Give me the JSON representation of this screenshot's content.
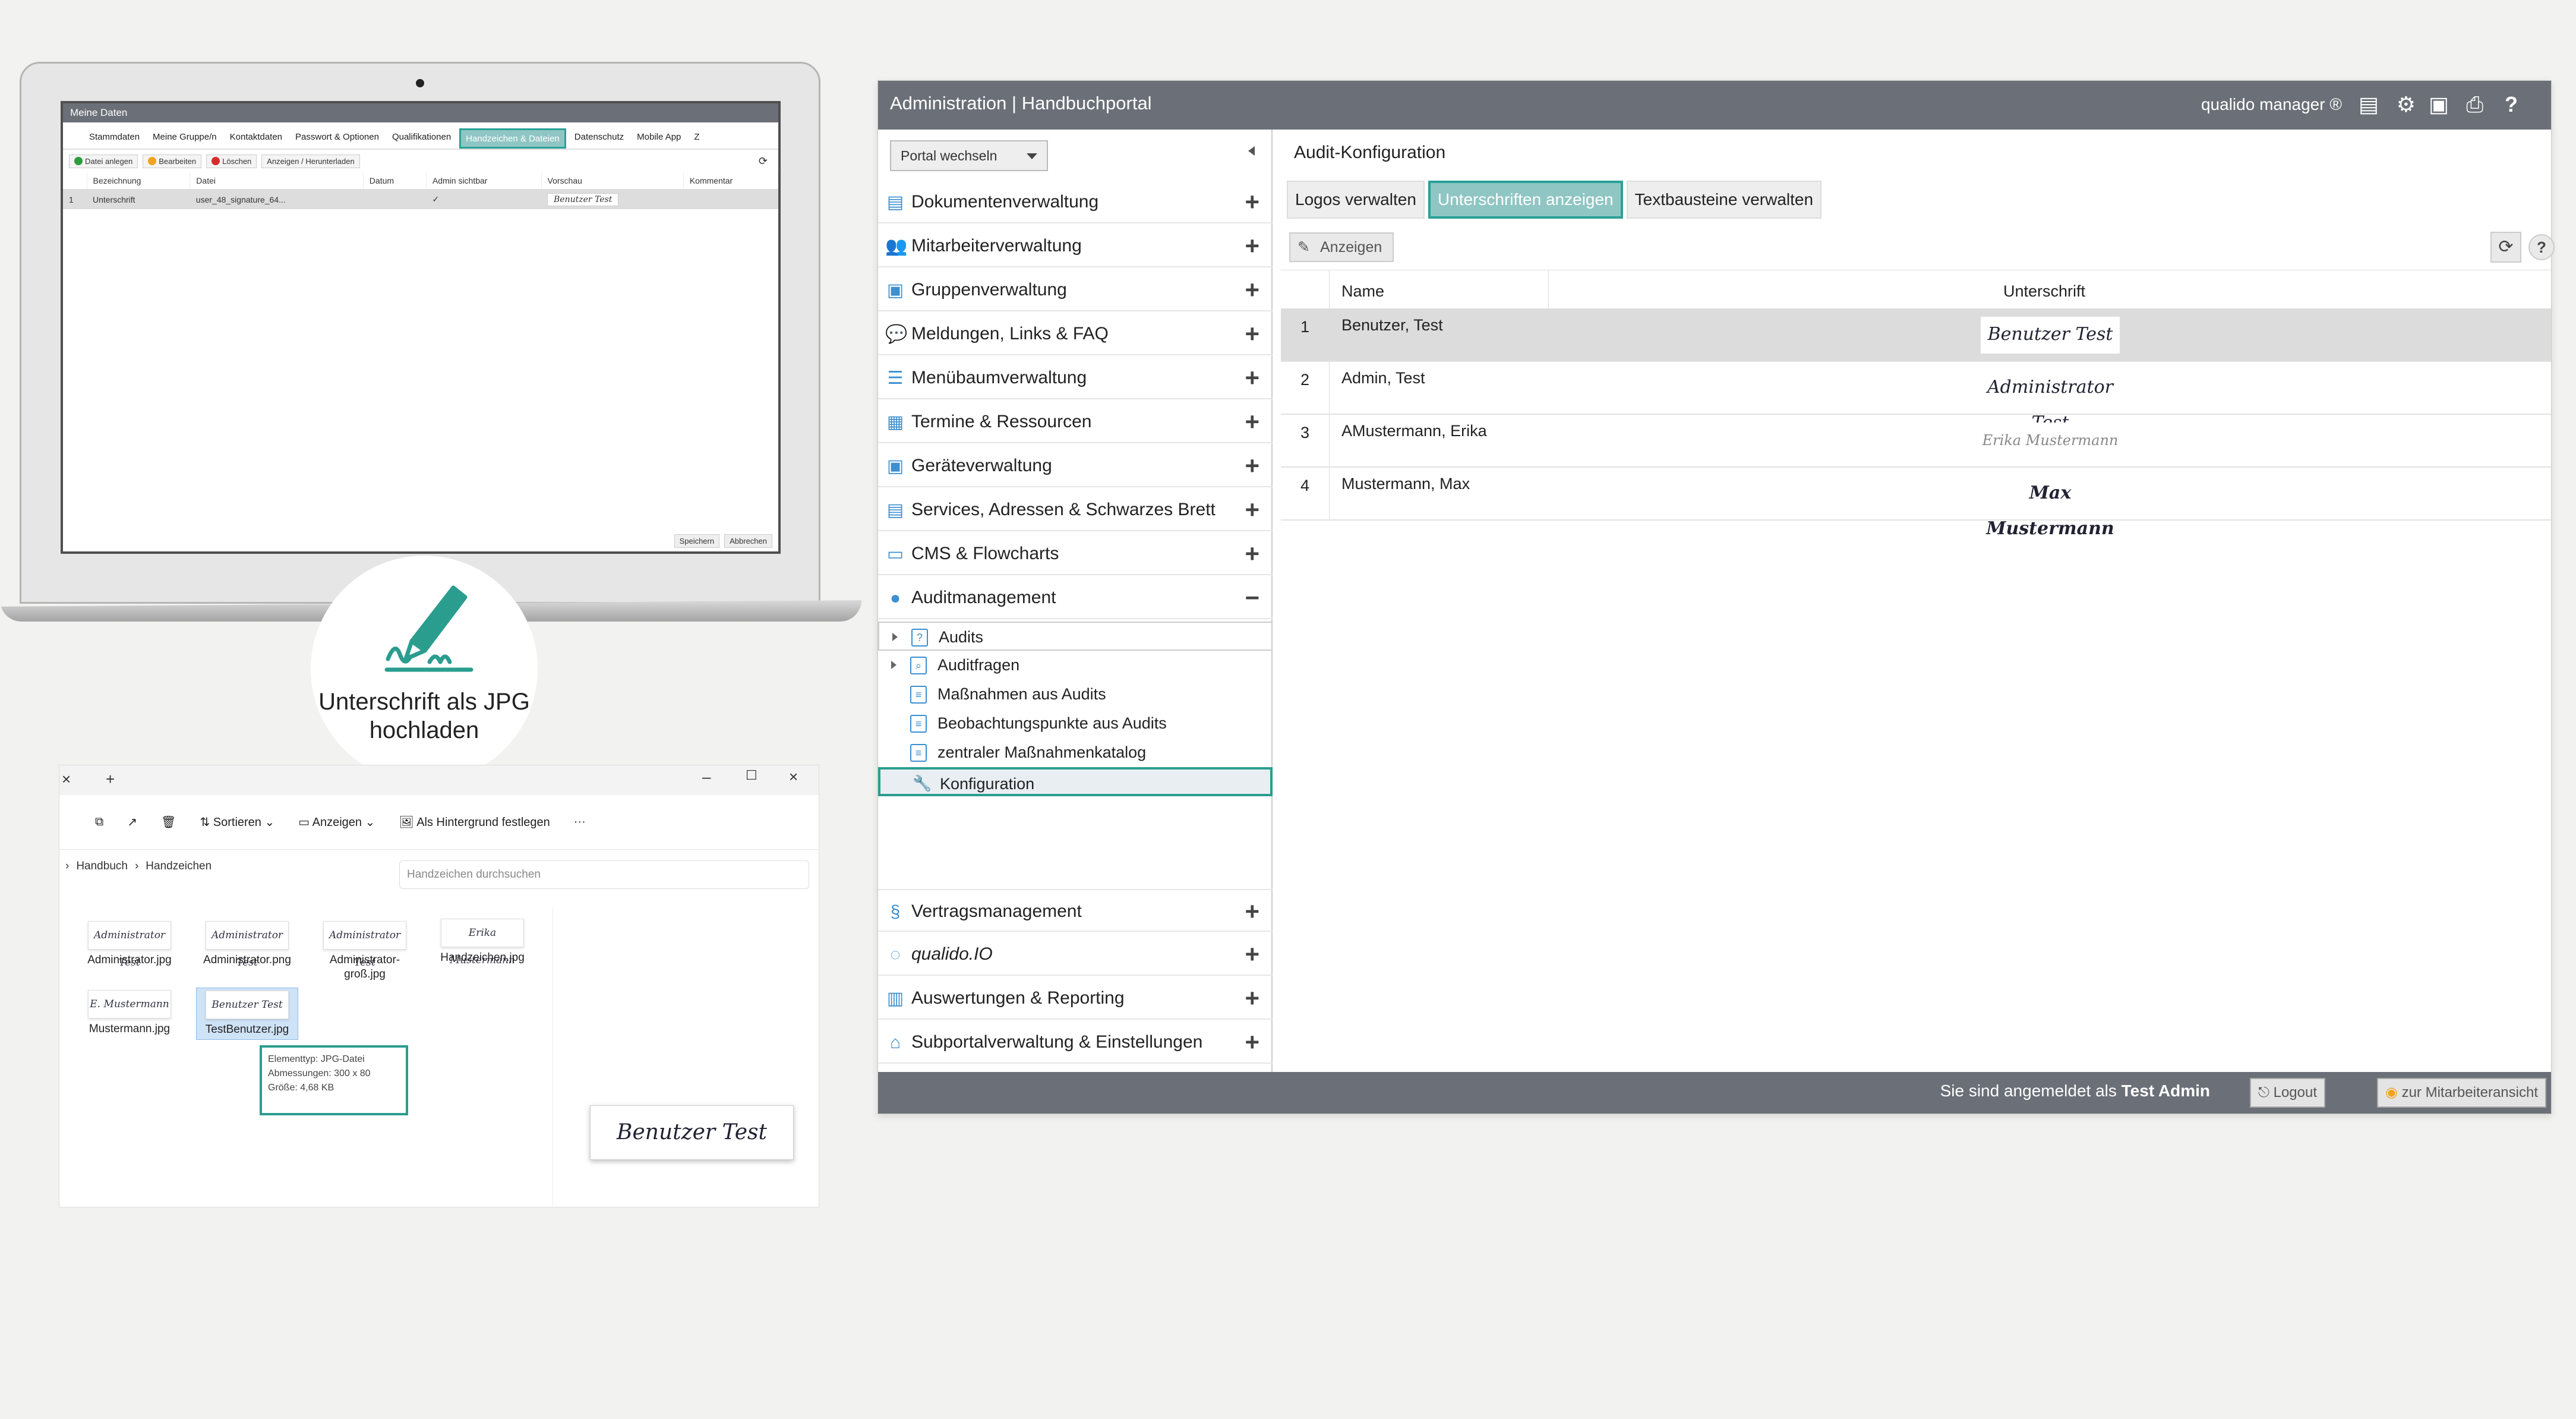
{
  "laptop": {
    "title": "Meine Daten",
    "tabs": [
      "Stammdaten",
      "Meine Gruppe/n",
      "Kontaktdaten",
      "Passwort & Optionen",
      "Qualifikationen",
      "Handzeichen & Dateien",
      "Datenschutz",
      "Mobile App",
      "Z"
    ],
    "toolbar": [
      "Datei anlegen",
      "Bearbeiten",
      "Löschen",
      "Anzeigen / Herunterladen"
    ],
    "columns": [
      "Bezeichnung",
      "Datei",
      "Datum",
      "Admin sichtbar",
      "Vorschau",
      "Kommentar"
    ],
    "row": {
      "num": "1",
      "name": "Unterschrift",
      "file": "user_48_signature_64...",
      "check": "✓",
      "preview": "Benutzer Test"
    },
    "footer": {
      "save": "Speichern",
      "cancel": "Abbrechen"
    }
  },
  "badge": {
    "line1": "Unterschrift als JPG",
    "line2": "hochladen"
  },
  "explorer": {
    "toolbar": {
      "sort": "Sortieren",
      "view": "Anzeigen",
      "background": "Als Hintergrund festlegen",
      "more": "···"
    },
    "path": [
      "Handbuch",
      "Handzeichen"
    ],
    "search_placeholder": "Handzeichen durchsuchen",
    "files": [
      {
        "name": "Administrator.jpg",
        "sig": "Administrator Test"
      },
      {
        "name": "Administrator.png",
        "sig": "Administrator Test"
      },
      {
        "name": "Administrator-groß.jpg",
        "sig": "Administrator Test"
      },
      {
        "name": "Handzeichen.jpg",
        "sig": "Erika Mustermann"
      },
      {
        "name": "Mustermann.jpg",
        "sig": "E. Mustermann"
      },
      {
        "name": "TestBenutzer.jpg",
        "sig": "Benutzer Test"
      }
    ],
    "tooltip": {
      "type": "Elementtyp: JPG-Datei",
      "dims": "Abmessungen: 300 x 80",
      "size": "Größe: 4,68 KB"
    },
    "preview_sig": "Benutzer Test"
  },
  "admin": {
    "title": "Administration | Handbuchportal",
    "brand": "qualido manager ®",
    "portal_switch": "Portal wechseln",
    "nav": [
      {
        "label": "Dokumentenverwaltung",
        "icon": "document-icon"
      },
      {
        "label": "Mitarbeiterverwaltung",
        "icon": "users-icon"
      },
      {
        "label": "Gruppenverwaltung",
        "icon": "group-icon"
      },
      {
        "label": "Meldungen, Links & FAQ",
        "icon": "chat-icon"
      },
      {
        "label": "Menübaumverwaltung",
        "icon": "list-icon"
      },
      {
        "label": "Termine & Ressourcen",
        "icon": "calendar-icon"
      },
      {
        "label": "Geräteverwaltung",
        "icon": "device-icon"
      },
      {
        "label": "Services, Adressen & Schwarzes Brett",
        "icon": "board-icon"
      },
      {
        "label": "CMS & Flowcharts",
        "icon": "cms-icon"
      },
      {
        "label": "Auditmanagement",
        "icon": "audit-icon"
      }
    ],
    "audit_sub": [
      "Audits",
      "Auditfragen",
      "Maßnahmen aus Audits",
      "Beobachtungspunkte aus Audits",
      "zentraler Maßnahmenkatalog",
      "Konfiguration"
    ],
    "nav_bottom": [
      {
        "label": "Vertragsmanagement",
        "icon": "paragraph-icon"
      },
      {
        "label": "qualido.IO",
        "icon": "io-icon"
      },
      {
        "label": "Auswertungen & Reporting",
        "icon": "chart-icon"
      },
      {
        "label": "Subportalverwaltung & Einstellungen",
        "icon": "home-icon"
      }
    ],
    "section_title": "Audit-Konfiguration",
    "tabs": [
      "Logos verwalten",
      "Unterschriften anzeigen",
      "Textbausteine verwalten"
    ],
    "show_button": "Anzeigen",
    "columns": {
      "name": "Name",
      "sig": "Unterschrift"
    },
    "rows": [
      {
        "num": "1",
        "name": "Benutzer, Test",
        "sig": "Benutzer Test"
      },
      {
        "num": "2",
        "name": "Admin, Test",
        "sig": "Administrator Test"
      },
      {
        "num": "3",
        "name": "AMustermann, Erika",
        "sig": "Erika Mustermann"
      },
      {
        "num": "4",
        "name": "Mustermann, Max",
        "sig": "Max Mustermann"
      }
    ],
    "footer": {
      "logged_prefix": "Sie sind angemeldet als",
      "user": "Test Admin",
      "logout": "Logout",
      "employee_view": "zur Mitarbeiteransicht"
    }
  },
  "colors": {
    "accent": "#2a9d8f",
    "header": "#6b6f77",
    "tab_active": "#8fc6c3",
    "nav_icon": "#3c8fd1"
  }
}
